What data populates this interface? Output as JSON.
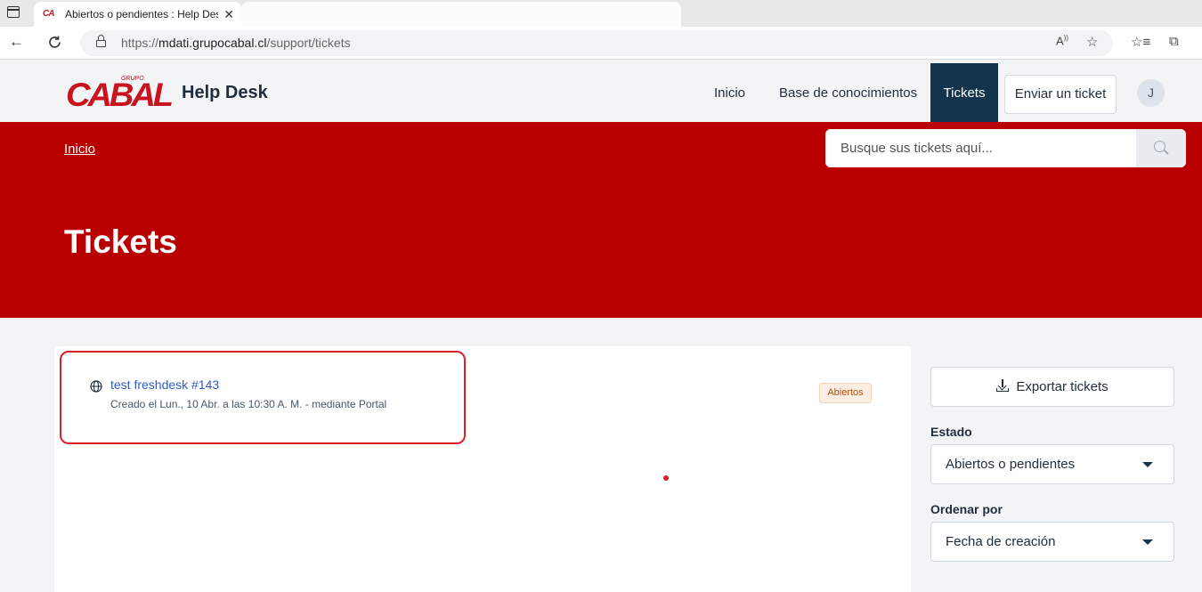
{
  "browser": {
    "tab_title": "Abiertos o pendientes : Help Desk",
    "tab_close": "✕",
    "url_prefix": "https://",
    "url_host": "mdati.grupocabal.cl",
    "url_path": "/support/tickets"
  },
  "header": {
    "logo_small": "GRUPO",
    "logo_text": "CABAL",
    "brand": "Help Desk",
    "nav": {
      "inicio": "Inicio",
      "base": "Base de conocimientos",
      "tickets": "Tickets"
    },
    "submit_ticket": "Enviar un ticket",
    "avatar_initial": "J"
  },
  "hero": {
    "breadcrumb": "Inicio",
    "search_placeholder": "Busque sus tickets aquí...",
    "title": "Tickets"
  },
  "tickets": [
    {
      "subject": "test freshdesk #143",
      "meta": "Creado el Lun., 10 Abr. a las 10:30 A. M. - mediante Portal",
      "status": "Abiertos"
    }
  ],
  "sidebar": {
    "export": "Exportar tickets",
    "status_label": "Estado",
    "status_value": "Abiertos o pendientes",
    "sort_label": "Ordenar por",
    "sort_value": "Fecha de creación"
  },
  "colors": {
    "brand_red": "#b80000",
    "nav_active": "#12344d",
    "link": "#2c5cc5",
    "highlight": "#d92027"
  }
}
